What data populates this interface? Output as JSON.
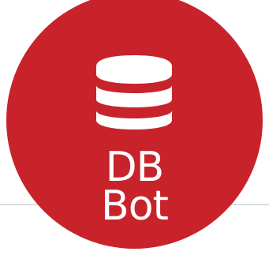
{
  "logo": {
    "line1": "DB",
    "line2": "Bot",
    "icon": "database-icon",
    "circle_color": "#c8232b",
    "text_color": "#ffffff"
  }
}
